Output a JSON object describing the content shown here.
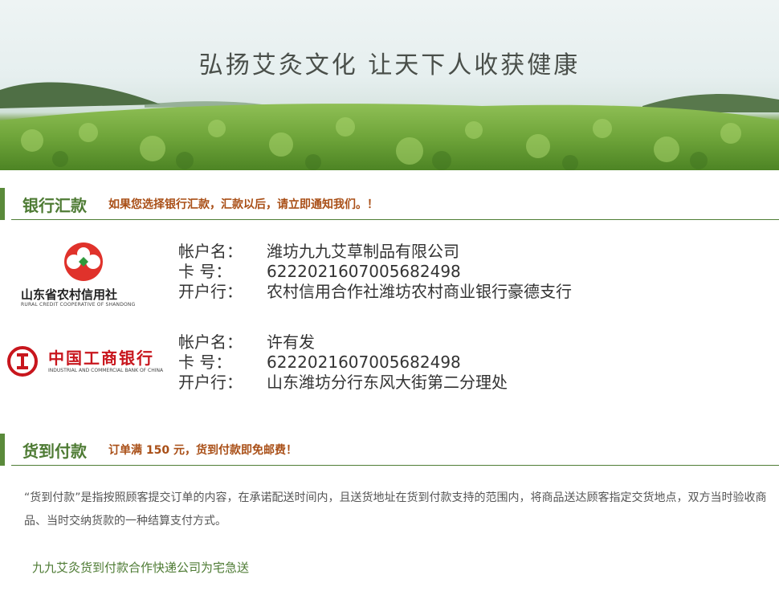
{
  "banner": {
    "slogan": "弘扬艾灸文化 让天下人收获健康"
  },
  "bank_transfer": {
    "title": "银行汇款",
    "note": "如果您选择银行汇款，汇款以后，请立即通知我们。！",
    "banks": [
      {
        "logo_name": "山东省农村信用社",
        "logo_subtext": "RURAL CREDIT COOPERATIVE OF SHANDONG",
        "account_label": "帐户名：",
        "account_value": "潍坊九九艾草制品有限公司",
        "card_label": "卡 号：",
        "card_value": "6222021607005682498",
        "branch_label": "开户行：",
        "branch_value": "农村信用合作社潍坊农村商业银行豪德支行"
      },
      {
        "logo_name": "中国工商银行",
        "logo_subtext": "INDUSTRIAL AND COMMERCIAL BANK OF CHINA",
        "account_label": "帐户名：",
        "account_value": "许有发",
        "card_label": "卡 号：",
        "card_value": "6222021607005682498",
        "branch_label": "开户行：",
        "branch_value": "山东潍坊分行东风大街第二分理处"
      }
    ]
  },
  "cod": {
    "title": "货到付款",
    "note": "订单满 150 元，货到付款即免邮费！",
    "description": "“货到付款”是指按照顾客提交订单的内容，在承诺配送时间内，且送货地址在货到付款支持的范围内，将商品送达顾客指定交货地点，双方当时验收商品、当时交纳货款的一种结算支付方式。",
    "partner": "九九艾灸货到付款合作快递公司为宅急送"
  },
  "colors": {
    "accent_green": "#4e7b34",
    "note_orange": "#a94f17",
    "rcc_red": "#e0322b",
    "icbc_red": "#c8161d"
  }
}
